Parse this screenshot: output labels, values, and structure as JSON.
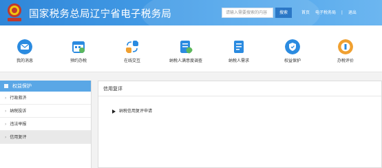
{
  "header": {
    "title": "国家税务总局辽宁省电子税务局",
    "search_placeholder": "请输入需要搜索的内容",
    "search_button": "搜索",
    "links": [
      "首页",
      "电子税务局",
      "|",
      "退出"
    ],
    "background_color": "#3b92e0"
  },
  "nav": {
    "items": [
      {
        "label": "我的消息",
        "icon": "message-icon",
        "color": "#2b8be0"
      },
      {
        "label": "预约办税",
        "icon": "calendar-icon",
        "color": "#2b8be0"
      },
      {
        "label": "在线交互",
        "icon": "interaction-icon",
        "color": "#2b8be0"
      },
      {
        "label": "纳税人满意度调查",
        "icon": "survey-icon",
        "color": "#2b8be0"
      },
      {
        "label": "纳税人需求",
        "icon": "demand-icon",
        "color": "#2b8be0"
      },
      {
        "label": "权益保护",
        "icon": "shield-icon",
        "color": "#2b8be0"
      },
      {
        "label": "办税评价",
        "icon": "evaluation-icon",
        "color": "#f0a030"
      }
    ]
  },
  "sidebar": {
    "title": "权益保护",
    "items": [
      {
        "label": "行政救济"
      },
      {
        "label": "纳税投诉"
      },
      {
        "label": "违法举报"
      },
      {
        "label": "信用复评"
      }
    ],
    "active_index": 3
  },
  "main": {
    "title": "信用复评",
    "tree_item": "纳税信用复评申请"
  }
}
